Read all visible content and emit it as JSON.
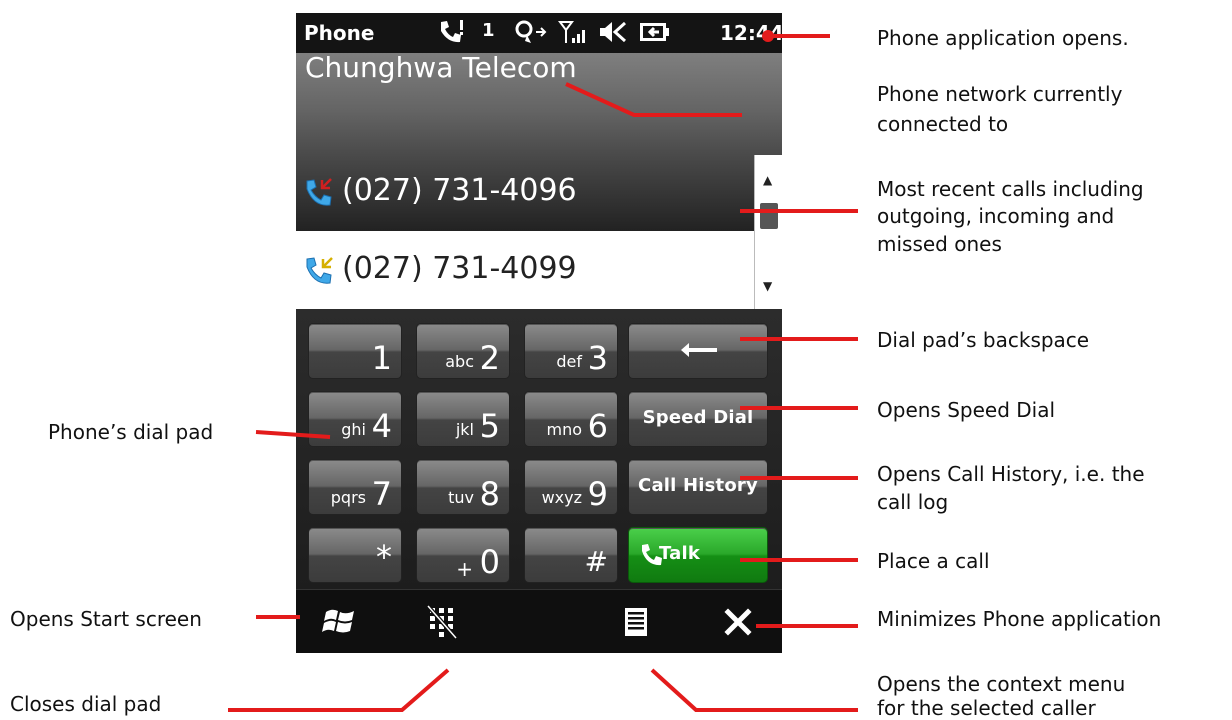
{
  "status_bar": {
    "title": "Phone",
    "signal_count": "1",
    "clock": "12:44"
  },
  "network": {
    "carrier": "Chunghwa Telecom"
  },
  "recent_calls": [
    {
      "number": "(027) 731-4096",
      "type": "outgoing",
      "selected": true
    },
    {
      "number": "(027) 731-4099",
      "type": "incoming",
      "selected": false
    }
  ],
  "keypad": {
    "keys": [
      {
        "digit": "1",
        "letters": ""
      },
      {
        "digit": "2",
        "letters": "abc"
      },
      {
        "digit": "3",
        "letters": "def"
      },
      {
        "digit": "4",
        "letters": "ghi"
      },
      {
        "digit": "5",
        "letters": "jkl"
      },
      {
        "digit": "6",
        "letters": "mno"
      },
      {
        "digit": "7",
        "letters": "pqrs"
      },
      {
        "digit": "8",
        "letters": "tuv"
      },
      {
        "digit": "9",
        "letters": "wxyz"
      },
      {
        "digit": "*",
        "letters": ""
      },
      {
        "digit": "0",
        "letters": "+"
      },
      {
        "digit": "#",
        "letters": ""
      }
    ],
    "backspace_icon": "arrow-left-icon",
    "speed_dial": "Speed Dial",
    "call_history": "Call History",
    "talk": "Talk"
  },
  "softkeys": {
    "start_icon": "windows-flag-icon",
    "close_dialpad_icon": "dialpad-off-icon",
    "menu_icon": "menu-list-icon",
    "minimize_icon": "close-x-icon"
  },
  "annotations": {
    "app_opens": "Phone application opens.",
    "network_1": "Phone network currently",
    "network_2": "connected to",
    "recent_1": "Most recent calls including",
    "recent_2": "outgoing, incoming and",
    "recent_3": "missed ones",
    "backspace": "Dial pad’s backspace",
    "speed_dial": "Opens Speed Dial",
    "call_history_1": "Opens Call History, i.e. the",
    "call_history_2": "call log",
    "place_call": "Place a call",
    "minimize": "Minimizes Phone application",
    "context_menu_1": "Opens the context menu",
    "context_menu_2": "for the selected caller",
    "dial_pad": "Phone’s dial pad",
    "start_screen": "Opens Start screen",
    "closes_dialpad": "Closes dial pad"
  },
  "colors": {
    "annotation_line": "#e31b1b",
    "talk_green": "#22a322",
    "selected_row": "#2f2f2f"
  }
}
